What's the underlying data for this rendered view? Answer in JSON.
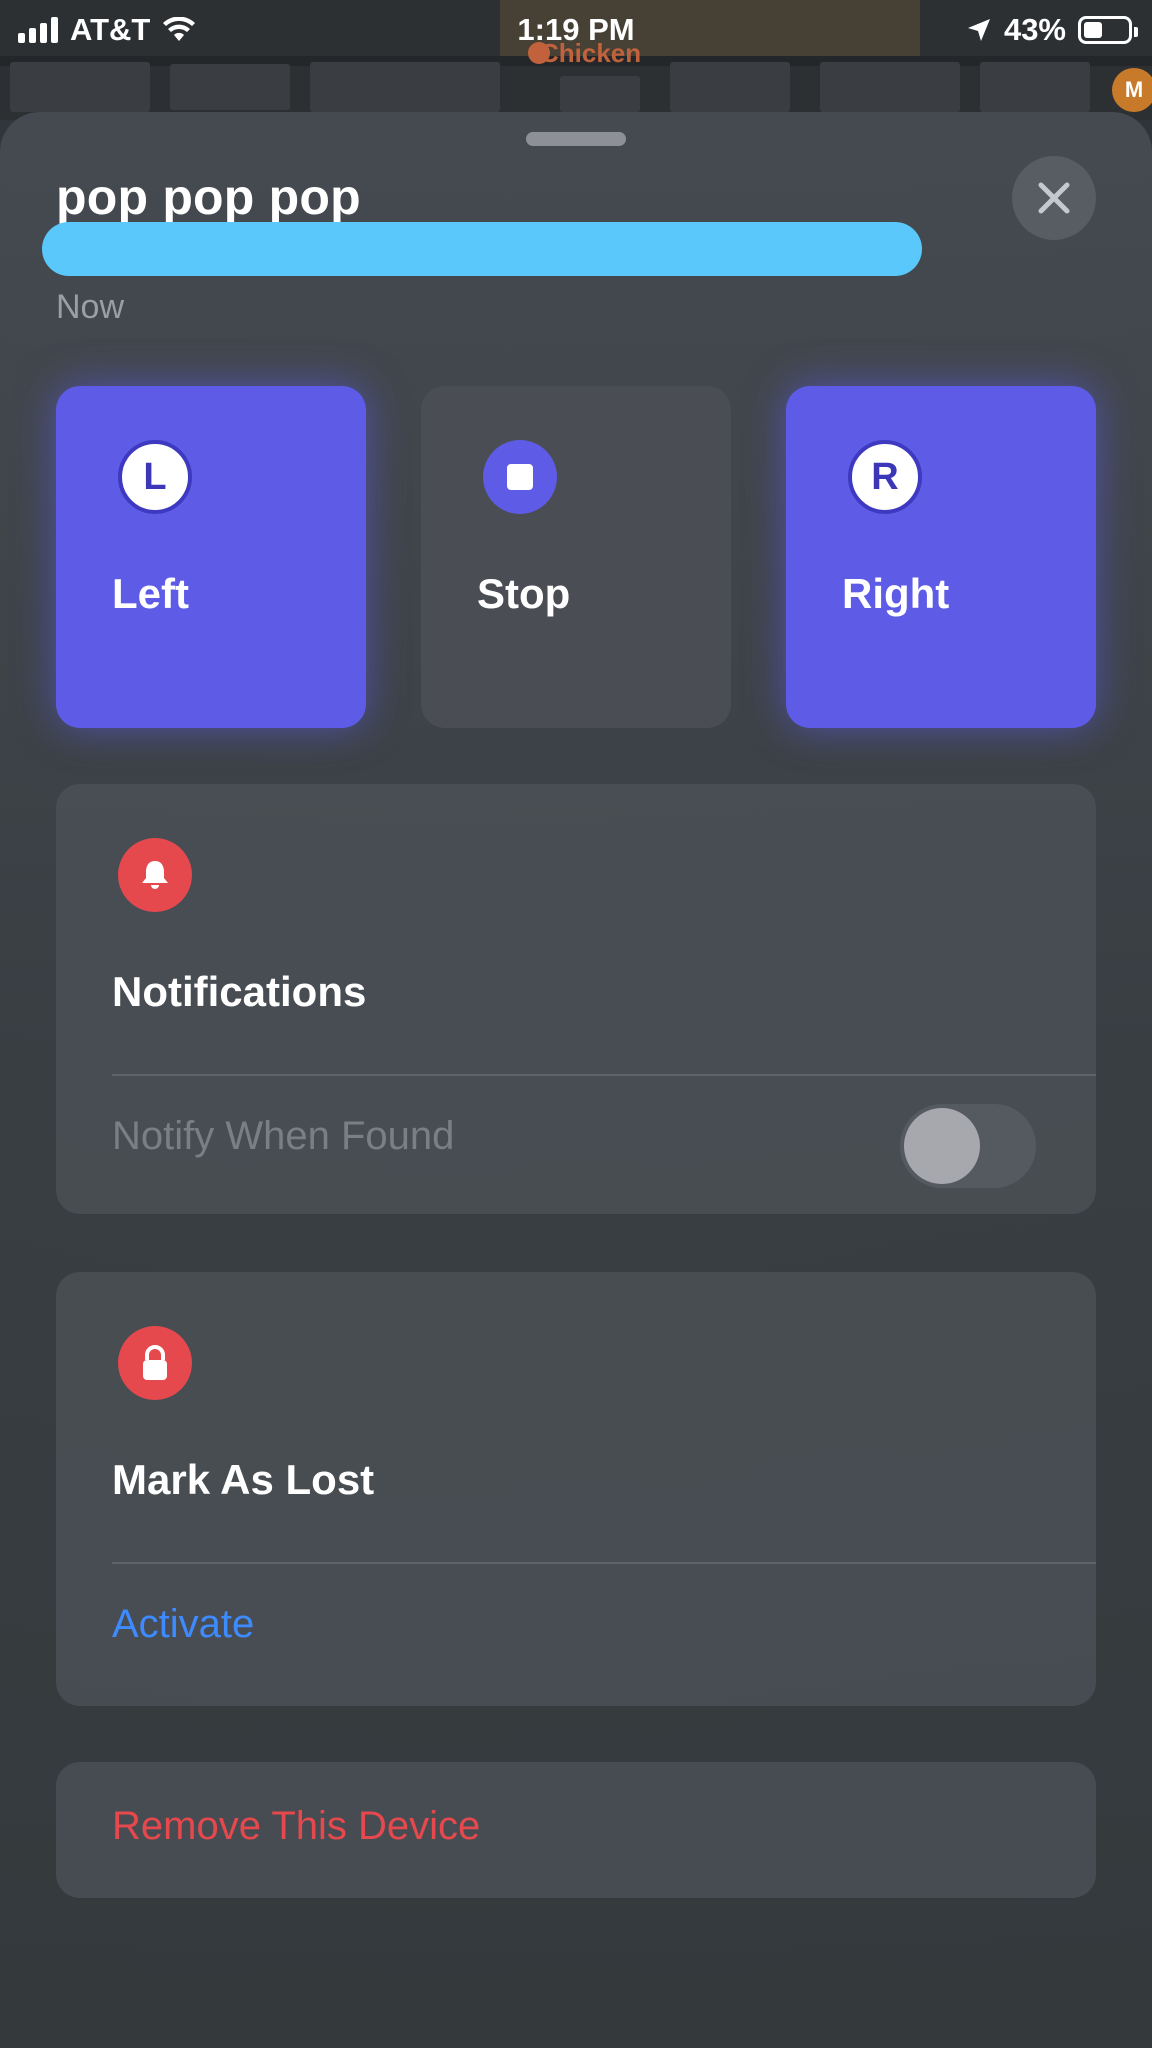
{
  "status_bar": {
    "carrier": "AT&T",
    "time": "1:19 PM",
    "battery_percent": "43%",
    "battery_level": 0.43,
    "icons": [
      "signal-bars-icon",
      "wifi-icon",
      "location-arrow-icon",
      "battery-icon"
    ]
  },
  "map": {
    "poi_label": "Chicken"
  },
  "header": {
    "title": "pop pop pop",
    "subtitle": "Now"
  },
  "actions": [
    {
      "label": "Left",
      "icon_letter": "L",
      "icon": "letter-l-icon"
    },
    {
      "label": "Stop",
      "icon": "stop-icon"
    },
    {
      "label": "Right",
      "icon_letter": "R",
      "icon": "letter-r-icon"
    }
  ],
  "notifications": {
    "title": "Notifications",
    "row_label": "Notify When Found",
    "toggle_on": false,
    "icon": "bell-icon"
  },
  "lost_mode": {
    "title": "Mark As Lost",
    "action_label": "Activate",
    "icon": "lock-icon"
  },
  "remove": {
    "label": "Remove This Device"
  },
  "colors": {
    "accent_purple": "#5e5ce6",
    "progress_blue": "#5ac8fa",
    "danger_red": "#e5484d",
    "link_blue": "#3d8bff"
  }
}
